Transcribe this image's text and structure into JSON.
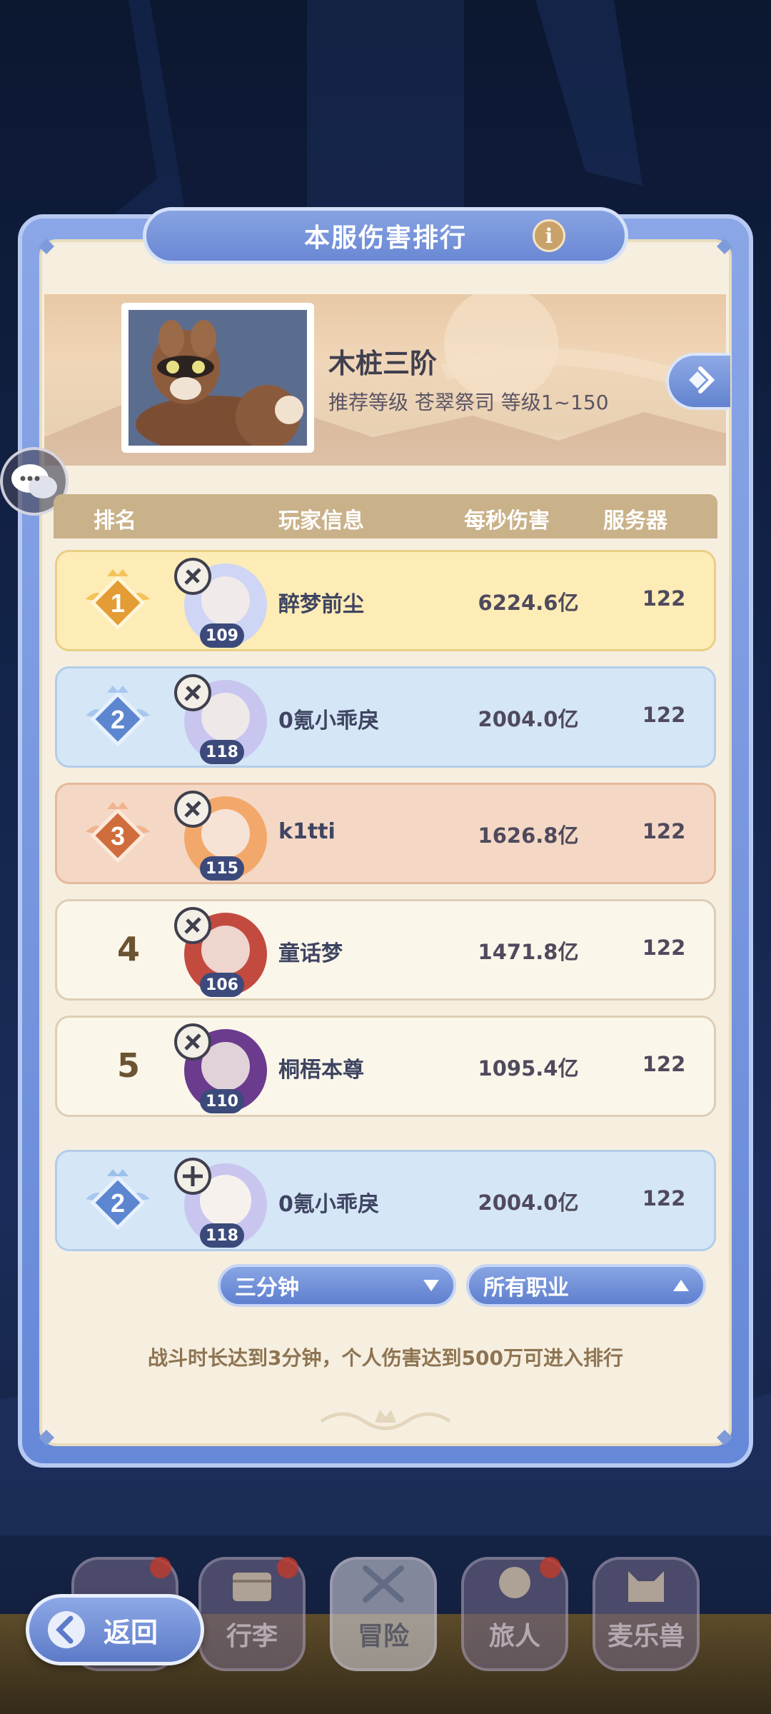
{
  "title_bar": {
    "title": "本服伤害排行",
    "info_icon": "i"
  },
  "boss": {
    "name": "木桩三阶",
    "subtitle": "推荐等级  苍翠祭司  等级1~150"
  },
  "table_header": {
    "rank": "排名",
    "player": "玩家信息",
    "dps": "每秒伤害",
    "server": "服务器"
  },
  "rows": [
    {
      "rank": "1",
      "badge": "gold-crown-badge",
      "name": "醉梦前尘",
      "level": "109",
      "dps": "6224.6亿",
      "server": "122",
      "bg": "#fdecb6",
      "border": "#e8cf85"
    },
    {
      "rank": "2",
      "badge": "silver-crown-badge",
      "name": "0氪小乖戾",
      "level": "118",
      "dps": "2004.0亿",
      "server": "122",
      "bg": "#d5e6f6",
      "border": "#b3cde9"
    },
    {
      "rank": "3",
      "badge": "bronze-crown-badge",
      "name": "k1tti",
      "level": "115",
      "dps": "1626.8亿",
      "server": "122",
      "bg": "#f4d8c5",
      "border": "#e4b99c"
    },
    {
      "rank": "4",
      "badge": "",
      "name": "童话梦",
      "level": "106",
      "dps": "1471.8亿",
      "server": "122",
      "bg": "#fbf6ea",
      "border": "#dccfb4"
    },
    {
      "rank": "5",
      "badge": "",
      "name": "桐梧本尊",
      "level": "110",
      "dps": "1095.4亿",
      "server": "122",
      "bg": "#fbf6ea",
      "border": "#dccfb4"
    }
  ],
  "my_row": {
    "rank": "2",
    "badge": "silver-crown-badge",
    "name": "0氪小乖戾",
    "level": "118",
    "dps": "2004.0亿",
    "server": "122"
  },
  "filters": {
    "time": "三分钟",
    "class": "所有职业"
  },
  "rule": "战斗时长达到3分钟，个人伤害达到500万可进入排行",
  "nav": {
    "back": "返回",
    "tabs": [
      "行李",
      "冒险",
      "旅人",
      "麦乐兽"
    ]
  },
  "colors": {
    "accent_blue": "#6a88d4",
    "panel": "#f6efe0",
    "header": "#c9b189"
  }
}
